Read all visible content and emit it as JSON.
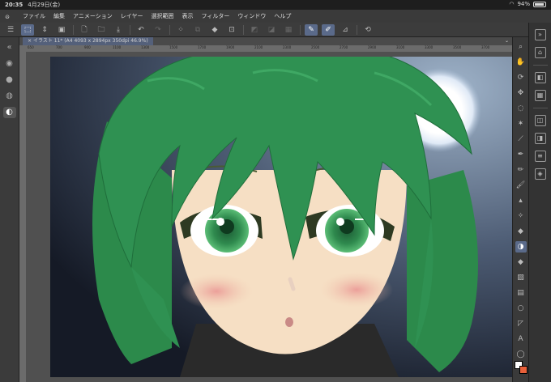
{
  "status": {
    "time": "20:35",
    "date": "4月29日(金)",
    "battery": "94%"
  },
  "menubar": {
    "items": [
      "ファイル",
      "編集",
      "アニメーション",
      "レイヤー",
      "選択範囲",
      "表示",
      "フィルター",
      "ウィンドウ",
      "ヘルプ"
    ]
  },
  "doc": {
    "tab_title": "イラスト 11* (A4 4093 x 2894px 350dpi 46.9%)"
  },
  "ruler": {
    "ticks": [
      "650",
      "700",
      "900",
      "1100",
      "1300",
      "1500",
      "1700",
      "1900",
      "2100",
      "2300",
      "2500",
      "2700",
      "2900",
      "3100",
      "3300",
      "3500",
      "3700"
    ]
  },
  "colors": {
    "main": "#ffffff",
    "sub": "#e8603a",
    "accent": "#5a6a8a"
  }
}
